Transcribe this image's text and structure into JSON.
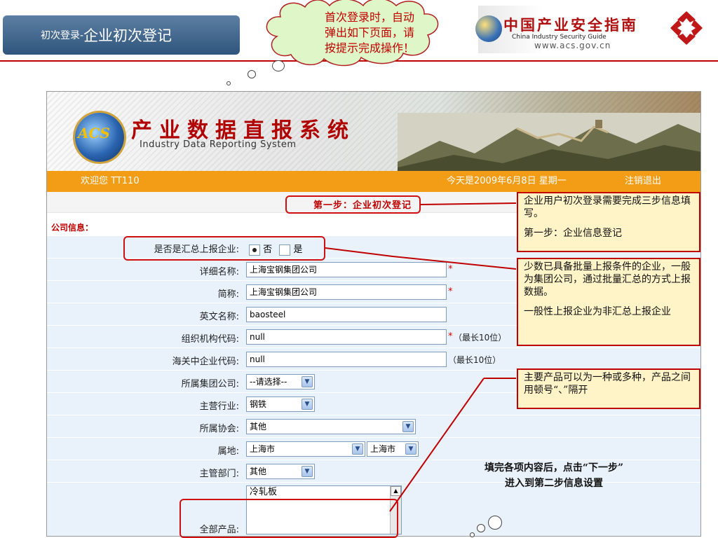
{
  "slide": {
    "title_small": "初次登录-",
    "title_large": "企业初次登记",
    "accent": "#c00000"
  },
  "top_cloud": {
    "text_lines": [
      "首次登录时，自动",
      "弹出如下页面，请",
      "按提示完成操作！"
    ]
  },
  "brand": {
    "name_cn": "中国产业安全指南",
    "name_en": "China  Industry  Security  Guide",
    "url": "www.acs.gov.cn",
    "icon": "acs-guide-logo-icon"
  },
  "app": {
    "logo_text": "ACS",
    "system_name_cn": "产业数据直报系统",
    "system_name_en": "Industry  Data  Reporting  System",
    "welcome": "欢迎您  TT110",
    "today": "今天是2009年6月8日   星期一",
    "logout": "注销退出",
    "step_title": "第一步：企业初次登记",
    "section_label": "公司信息：",
    "form": {
      "is_aggregate": {
        "label": "是否是汇总上报企业:",
        "opt_no": "否",
        "opt_yes": "是",
        "selected": "否"
      },
      "full_name": {
        "label": "详细名称:",
        "value": "上海宝钢集团公司",
        "required": "*"
      },
      "short_name": {
        "label": "简称:",
        "value": "上海宝钢集团公司",
        "required": "*"
      },
      "english_name": {
        "label": "英文名称:",
        "value": "baosteel"
      },
      "org_code": {
        "label": "组织机构代码:",
        "value": "null",
        "required": "*",
        "hint": "（最长10位）"
      },
      "customs_code": {
        "label": "海关中企业代码:",
        "value": "null",
        "hint": "（最长10位）"
      },
      "group": {
        "label": "所属集团公司:",
        "value": "--请选择--"
      },
      "industry": {
        "label": "主营行业:",
        "value": "钢铁"
      },
      "association": {
        "label": "所属协会:",
        "value": "其他"
      },
      "location": {
        "label": "属地:",
        "province": "上海市",
        "city": "上海市"
      },
      "department": {
        "label": "主管部门:",
        "value": "其他"
      },
      "products": {
        "label": "全部产品:",
        "value": "冷轧板"
      }
    }
  },
  "callouts": {
    "first_step": [
      "企业用户初次登录需要完成三步信息填写。",
      "第一步：企业信息登记"
    ],
    "aggregate": [
      "少数已具备批量上报条件的企业，一般为集团公司，通过批量汇总的方式上报数据。",
      "一般性上报企业为非汇总上报企业"
    ],
    "products": [
      "主要产品可以为一种或多种，产品之间用顿号“、”隔开"
    ]
  },
  "bottom_cloud": {
    "text_lines": [
      "填完各项内容后，点击“下一步”",
      "进入到第二步信息设置"
    ]
  }
}
